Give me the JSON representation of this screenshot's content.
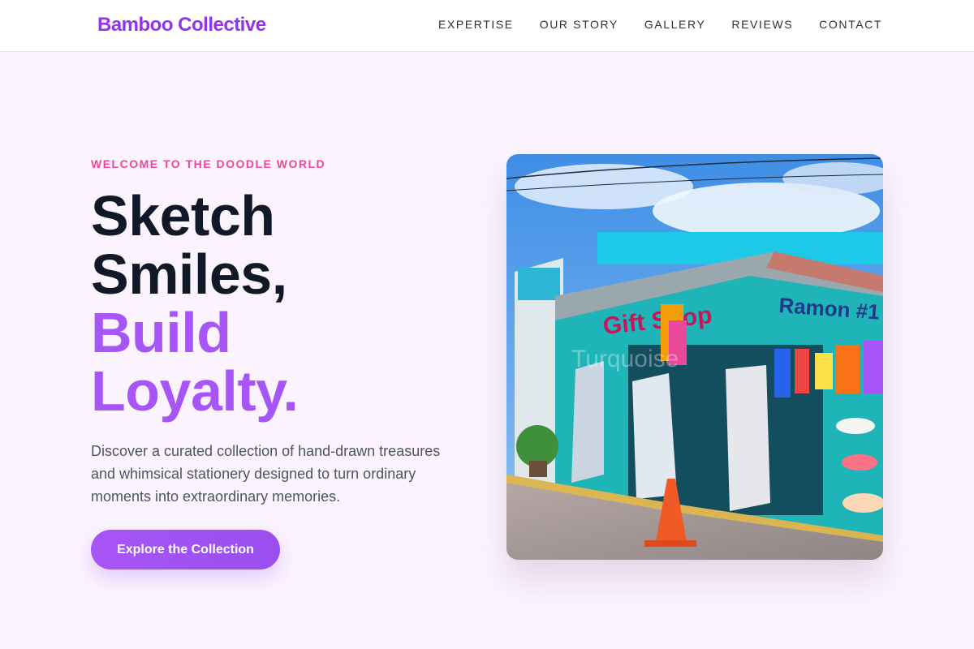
{
  "brand": {
    "name": "Bamboo Collective",
    "color": "#9333ea"
  },
  "nav": {
    "items": [
      {
        "label": "EXPERTISE"
      },
      {
        "label": "OUR STORY"
      },
      {
        "label": "GALLERY"
      },
      {
        "label": "REVIEWS"
      },
      {
        "label": "CONTACT"
      }
    ]
  },
  "hero": {
    "eyebrow": "WELCOME TO THE DOODLE WORLD",
    "headline": {
      "line1": "Sketch",
      "line2": "Smiles,",
      "line3": "Build",
      "line4": "Loyalty."
    },
    "description": "Discover a curated collection of hand-drawn treasures and whimsical stationery designed to turn ordinary moments into extraordinary memories.",
    "cta_label": "Explore the Collection",
    "image": {
      "description_icon": "shop-storefront-image",
      "sign_left": "Gift Shop",
      "sign_right": "Ramon #1",
      "watermark": "Turquoise"
    }
  },
  "colors": {
    "accent": "#a855f7",
    "eyebrow": "#ec4899",
    "background": "#fbf4fe",
    "heading": "#111827"
  }
}
